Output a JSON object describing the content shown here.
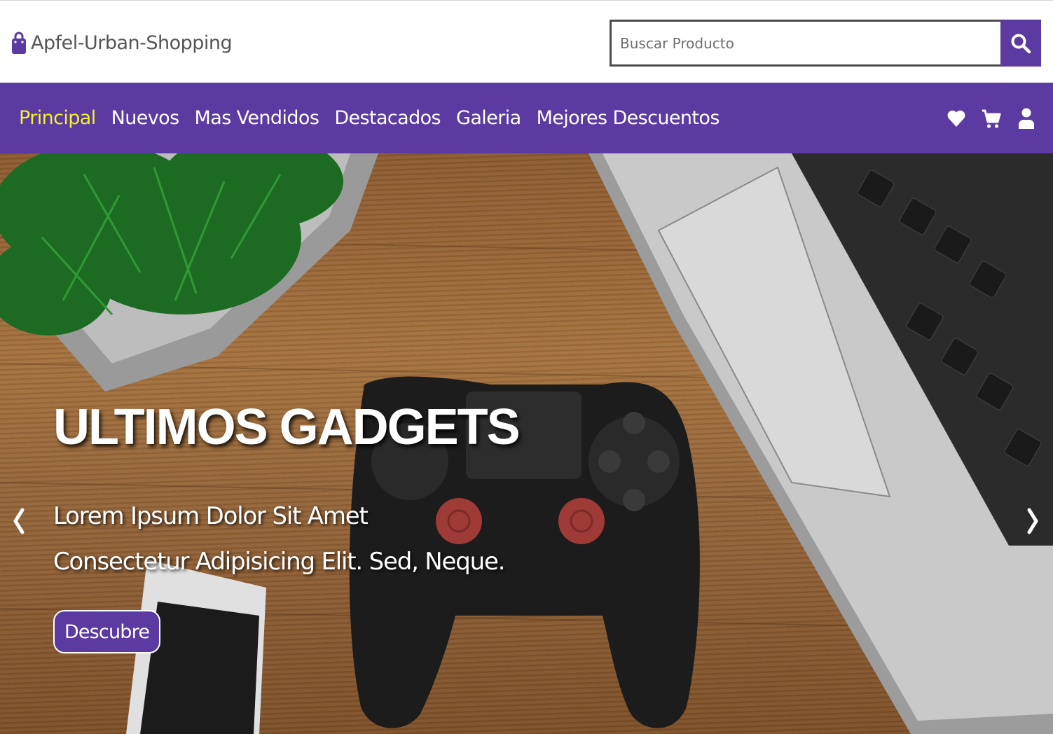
{
  "brand": {
    "name": "Apfel-Urban-Shopping",
    "icon": "shopping-bag-icon"
  },
  "search": {
    "placeholder": "Buscar Producto",
    "value": "",
    "button_icon": "search-icon"
  },
  "nav": {
    "links": [
      {
        "label": "Principal",
        "active": true
      },
      {
        "label": "Nuevos",
        "active": false
      },
      {
        "label": "Mas Vendidos",
        "active": false
      },
      {
        "label": "Destacados",
        "active": false
      },
      {
        "label": "Galeria",
        "active": false
      },
      {
        "label": "Mejores Descuentos",
        "active": false
      }
    ],
    "icons": [
      "heart-icon",
      "cart-icon",
      "user-icon"
    ]
  },
  "hero": {
    "title": "ULTIMOS GADGETS",
    "line1": "Lorem Ipsum Dolor Sit Amet",
    "line2": "Consectetur Adipisicing Elit. Sed, Neque.",
    "cta": "Descubre",
    "prev_icon": "chevron-left-icon",
    "next_icon": "chevron-right-icon"
  },
  "colors": {
    "primary": "#5b3aa1",
    "active_link": "#f3f12c",
    "text_dark": "#555555"
  }
}
